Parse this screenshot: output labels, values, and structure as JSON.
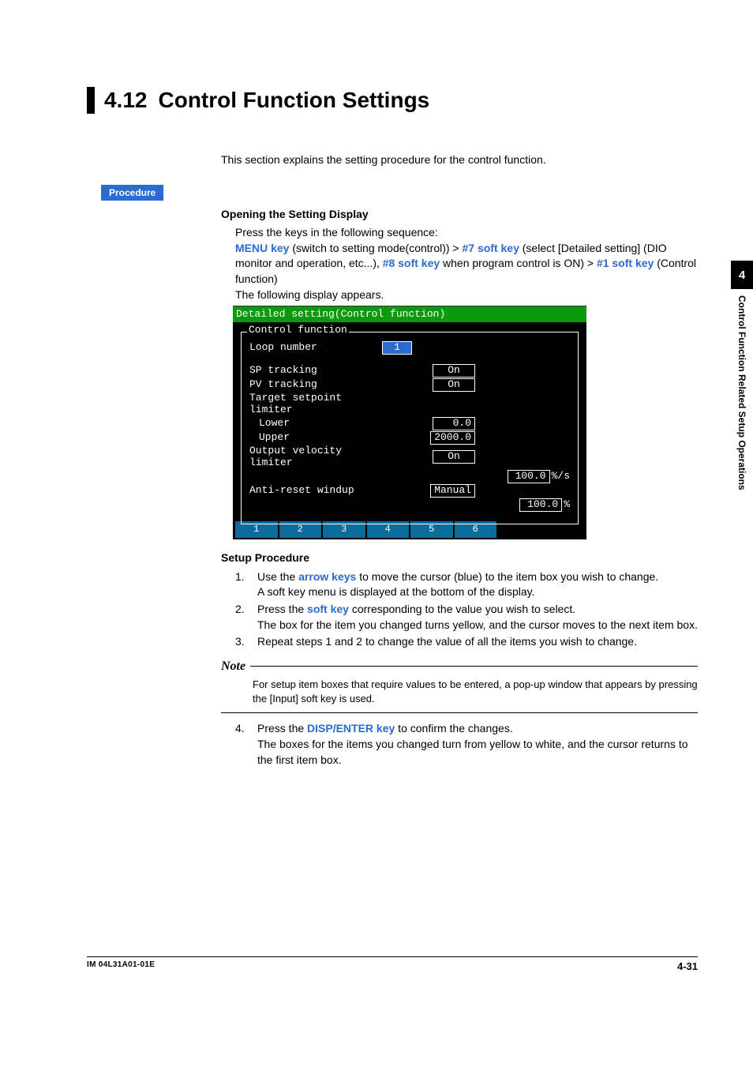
{
  "heading": {
    "number": "4.12",
    "title": "Control Function Settings"
  },
  "intro": "This section explains the setting procedure for the control function.",
  "procedure_label": "Procedure",
  "opening": {
    "heading": "Opening the Setting Display",
    "lead": "Press the keys in the following sequence:",
    "menu_key": "MENU key",
    "menu_after": " (switch to setting mode(control)) > ",
    "k7": "#7 soft key",
    "k7_after": " (select [Detailed setting] (DIO monitor and operation, etc...), ",
    "k8": "#8 soft key",
    "k8_after": " when program control is ON) > ",
    "k1": "#1 soft key",
    "k1_after": " (Control function)",
    "appears": "The following display appears."
  },
  "panel": {
    "title": "Detailed setting(Control function)",
    "fieldset": "Control function",
    "loop_label": "Loop number",
    "loop_value": "1",
    "rows": [
      {
        "label": "SP tracking",
        "value": "On",
        "cls": "on"
      },
      {
        "label": "PV tracking",
        "value": "On",
        "cls": "on"
      },
      {
        "label": "Target setpoint limiter",
        "value": null
      },
      {
        "label": "Lower",
        "value": "0.0",
        "sub": true
      },
      {
        "label": "Upper",
        "value": "2000.0",
        "sub": true
      },
      {
        "label": "Output velocity limiter",
        "value": "On",
        "cls": "on"
      },
      {
        "label": "",
        "value": "100.0",
        "unit": "%/s"
      },
      {
        "label": "Anti-reset windup",
        "value": "Manual"
      },
      {
        "label": "",
        "value": "100.0",
        "unit": "%"
      }
    ],
    "softkeys": [
      "1",
      "2",
      "3",
      "4",
      "5",
      "6",
      "",
      ""
    ]
  },
  "setup": {
    "heading": "Setup Procedure",
    "s1a": "Use the ",
    "s1_key": "arrow keys",
    "s1b": " to move the cursor (blue) to the item box you wish to change.",
    "s1c": "A soft key menu is displayed at the bottom of the display.",
    "s2a": "Press the ",
    "s2_key": "soft key",
    "s2b": " corresponding to the value you wish to select.",
    "s2c": "The box for the item you changed turns yellow, and the cursor moves to the next item box.",
    "s3": "Repeat steps 1 and 2 to change the value of all the items you wish to change."
  },
  "note": {
    "label": "Note",
    "text": "For setup item boxes that require values to be entered, a pop-up window that appears by pressing the [Input] soft key is used."
  },
  "step4": {
    "a": "Press the ",
    "key": "DISP/ENTER key",
    "b": " to confirm the changes.",
    "c": "The boxes for the items you changed turn from yellow to white, and the cursor returns to the first item box."
  },
  "side": {
    "chapter": "4",
    "title": "Control Function Related Setup Operations"
  },
  "footer": {
    "doc": "IM 04L31A01-01E",
    "page": "4-31"
  }
}
